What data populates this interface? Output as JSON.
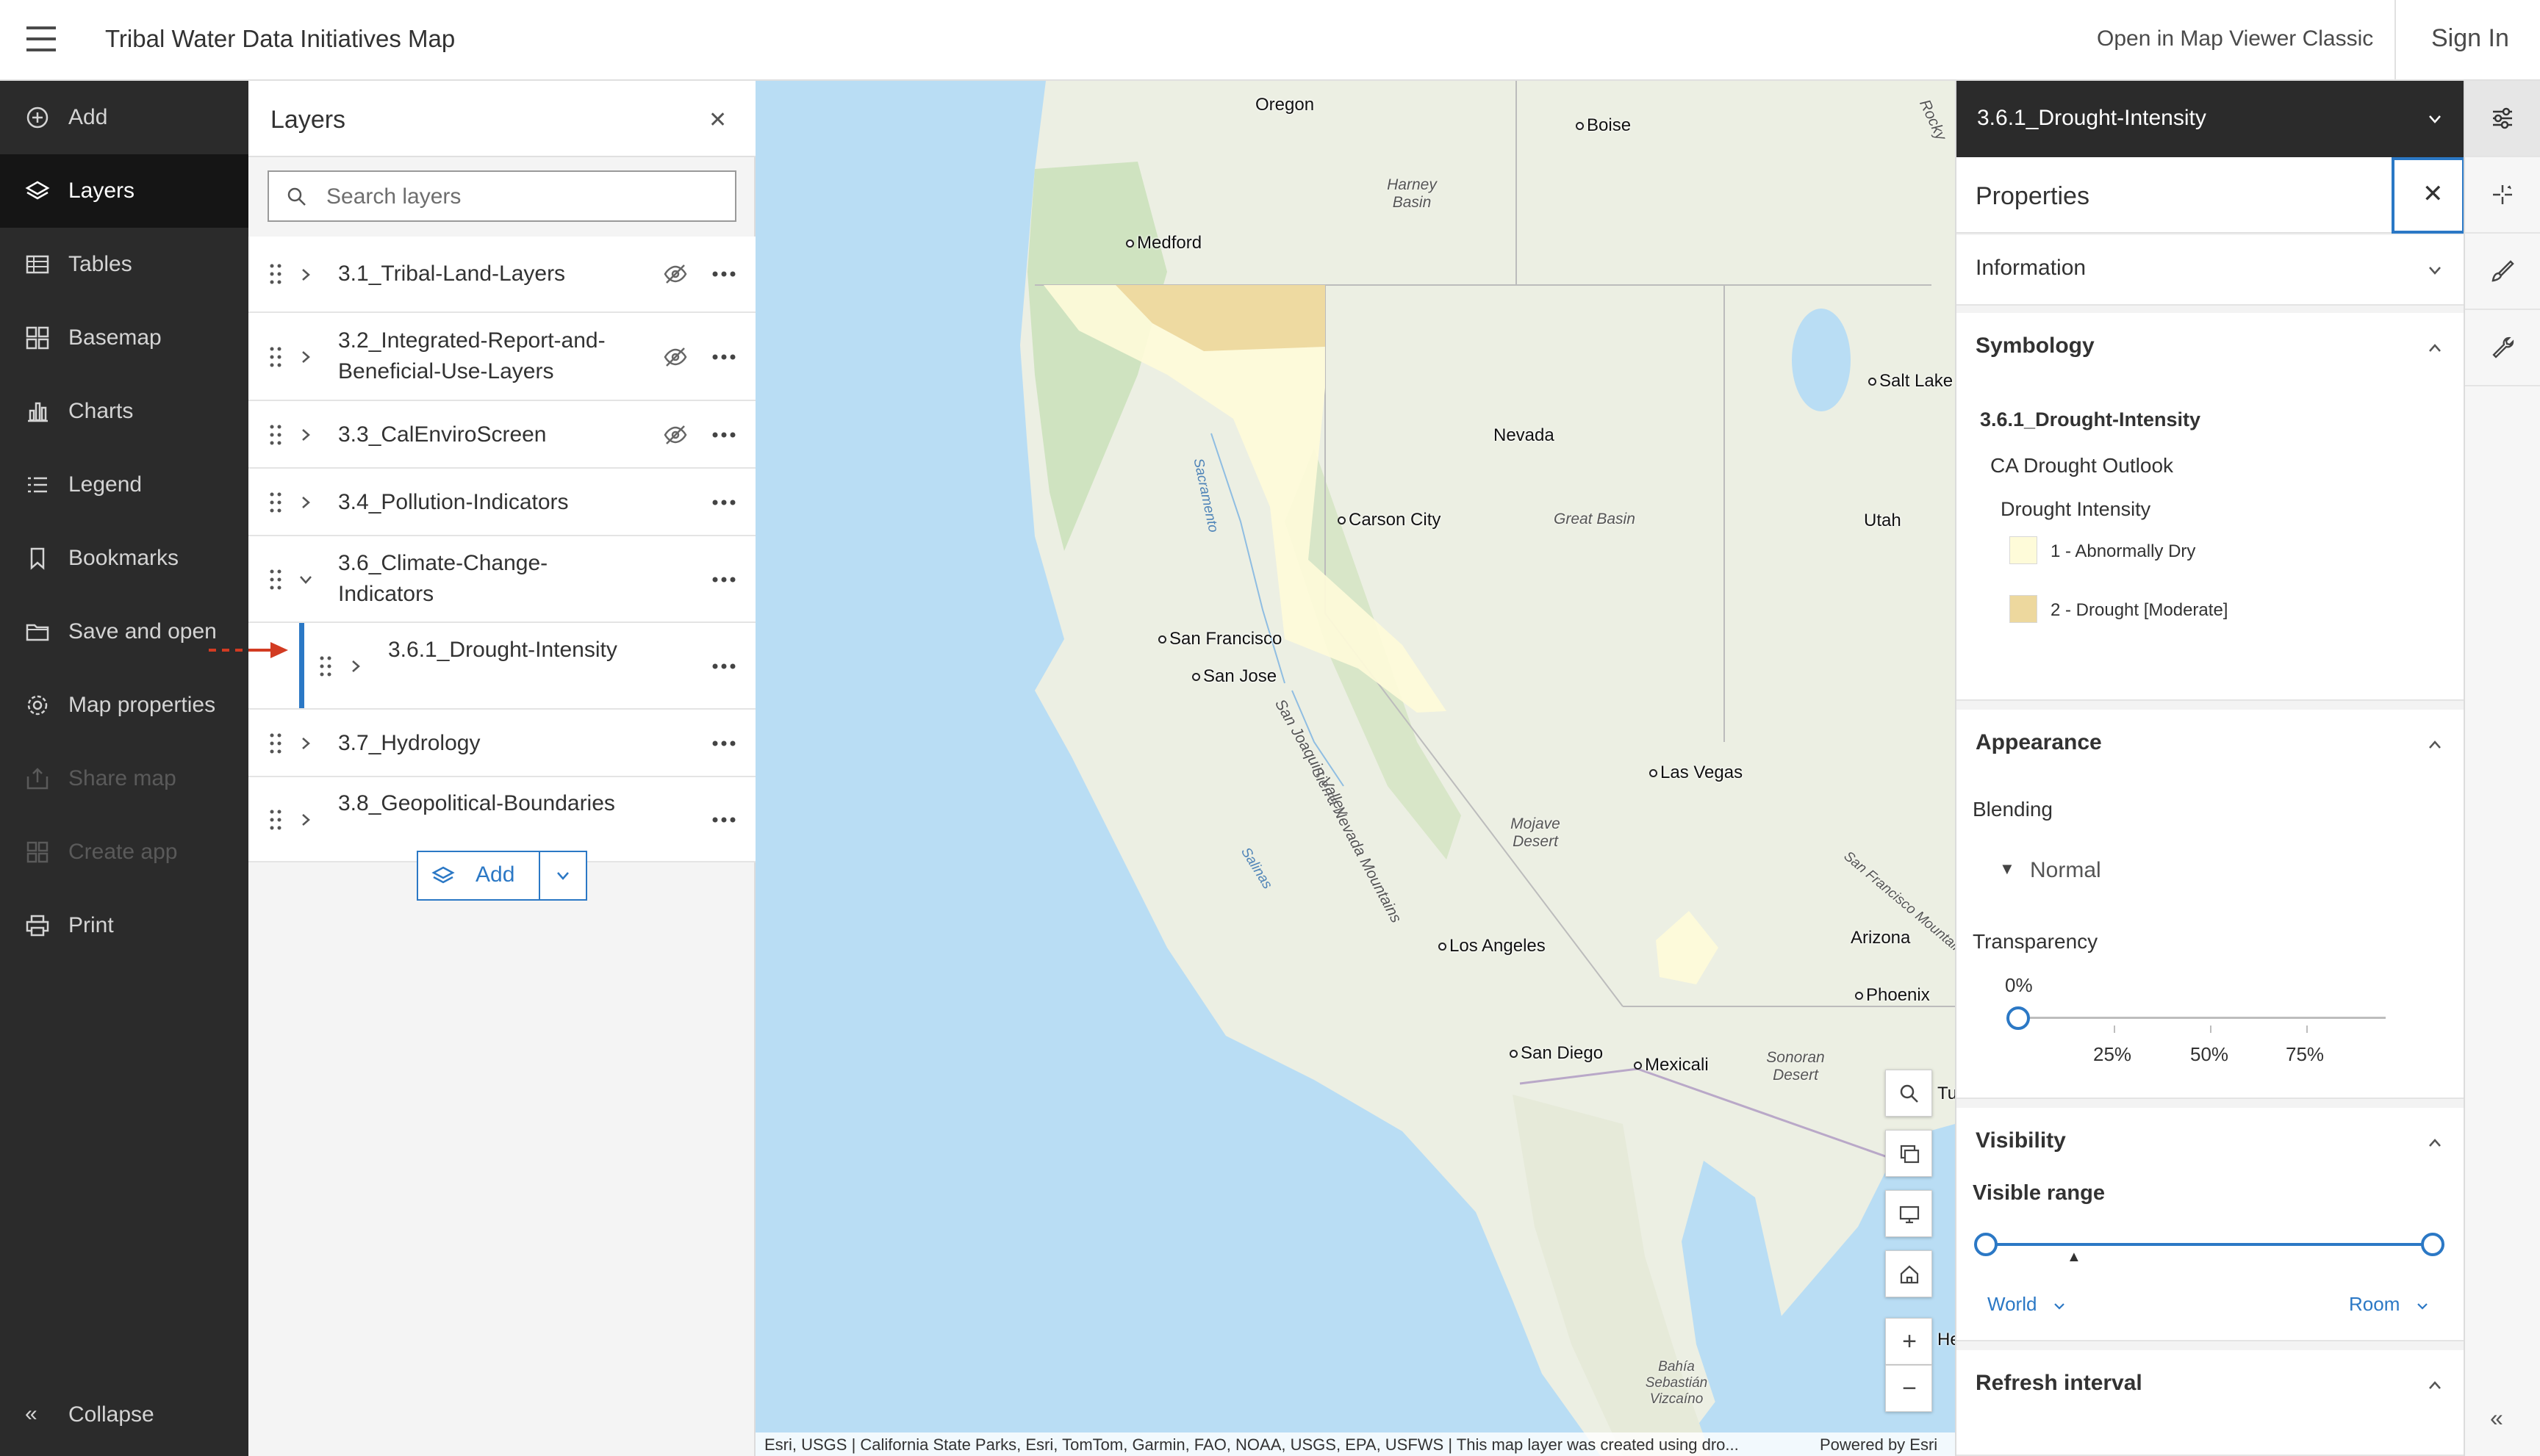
{
  "header": {
    "app_title": "Tribal Water Data Initiatives Map",
    "open_classic": "Open in Map Viewer Classic",
    "sign_in": "Sign In"
  },
  "nav": {
    "items": [
      {
        "label": "Add",
        "icon": "plus-circle-icon",
        "state": "normal"
      },
      {
        "label": "Layers",
        "icon": "layers-icon",
        "state": "active"
      },
      {
        "label": "Tables",
        "icon": "table-icon",
        "state": "normal"
      },
      {
        "label": "Basemap",
        "icon": "basemap-grid-icon",
        "state": "normal"
      },
      {
        "label": "Charts",
        "icon": "bar-chart-icon",
        "state": "normal"
      },
      {
        "label": "Legend",
        "icon": "legend-list-icon",
        "state": "normal"
      },
      {
        "label": "Bookmarks",
        "icon": "bookmark-icon",
        "state": "normal"
      },
      {
        "label": "Save and open",
        "icon": "folder-icon",
        "state": "normal"
      },
      {
        "label": "Map properties",
        "icon": "gear-icon",
        "state": "normal"
      },
      {
        "label": "Share map",
        "icon": "share-icon",
        "state": "disabled"
      },
      {
        "label": "Create app",
        "icon": "grid-app-icon",
        "state": "disabled"
      },
      {
        "label": "Print",
        "icon": "printer-icon",
        "state": "normal"
      }
    ],
    "collapse_label": "Collapse"
  },
  "layers_panel": {
    "title": "Layers",
    "search_placeholder": "Search layers",
    "layers": [
      {
        "name": "3.1_Tribal-Land-Layers",
        "hidden": true,
        "expanded": false
      },
      {
        "name": "3.2_Integrated-Report-and-Beneficial-Use-Layers",
        "hidden": true,
        "expanded": false
      },
      {
        "name": "3.3_CalEnviroScreen",
        "hidden": true,
        "expanded": false
      },
      {
        "name": "3.4_Pollution-Indicators",
        "hidden": false,
        "expanded": false
      },
      {
        "name": "3.6_Climate-Change-Indicators",
        "hidden": false,
        "expanded": true
      },
      {
        "name": "3.6.1_Drought-Intensity",
        "hidden": false,
        "expanded": false,
        "selected": true
      },
      {
        "name": "3.7_Hydrology",
        "hidden": false,
        "expanded": false
      },
      {
        "name": "3.8_Geopolitical-Boundaries",
        "hidden": false,
        "expanded": false
      }
    ],
    "add_label": "Add"
  },
  "map": {
    "places": [
      "Oregon",
      "Boise",
      "Medford",
      "Salt Lake C",
      "Nevada",
      "Carson City",
      "Utah",
      "San Francisco",
      "San Jose",
      "Las Vegas",
      "Los Angeles",
      "Arizona",
      "Phoenix",
      "San Diego",
      "Mexicali",
      "Tu",
      "He"
    ],
    "regions": [
      "Harney Basin",
      "Great Basin",
      "Mojave Desert",
      "Sonoran Desert",
      "Bahía Sebastián Vizcaíno",
      "Sierra Nevada Mountains",
      "San Joaquin Valley",
      "San Francisco Mountains",
      "Rocky"
    ],
    "water_labels": [
      "Sacramento",
      "Salinas"
    ],
    "attribution": "Esri, USGS | California State Parks, Esri, TomTom, Garmin, FAO, NOAA, USGS, EPA, USFWS | This map layer was created using dro...",
    "powered_by": "Powered by Esri",
    "controls": [
      "search-icon",
      "basemap-toggle-icon",
      "screen-icon",
      "home-icon",
      "zoom-in-icon",
      "zoom-out-icon"
    ]
  },
  "properties": {
    "layer_selector": "3.6.1_Drought-Intensity",
    "title": "Properties",
    "information_title": "Information",
    "symbology": {
      "title": "Symbology",
      "layer_name": "3.6.1_Drought-Intensity",
      "sublayer": "CA Drought Outlook",
      "field": "Drought Intensity",
      "classes": [
        {
          "label": "1 - Abnormally Dry",
          "color": "#fefbd9"
        },
        {
          "label": "2 - Drought [Moderate]",
          "color": "#edd89e"
        }
      ]
    },
    "appearance": {
      "title": "Appearance",
      "blending_label": "Blending",
      "blending_value": "Normal",
      "transparency_label": "Transparency",
      "transparency_value": "0%",
      "ticks": [
        "25%",
        "50%",
        "75%"
      ]
    },
    "visibility": {
      "title": "Visibility",
      "range_label": "Visible range",
      "min_scale": "World",
      "max_scale": "Room"
    },
    "refresh": {
      "title": "Refresh interval"
    }
  },
  "colors": {
    "accent": "#2b78c5",
    "dark_nav": "#2b2b2b",
    "drought_abnormally_dry": "#fefbd9",
    "drought_moderate": "#edd89e"
  }
}
